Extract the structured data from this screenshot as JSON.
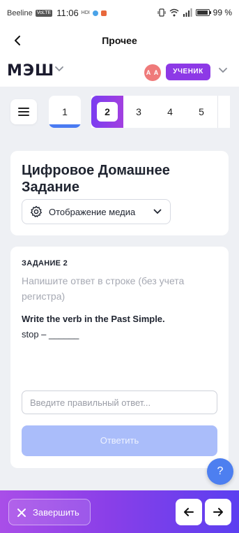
{
  "status_bar": {
    "carrier": "Beeline",
    "network_badge": "VoLTE",
    "time": "11:06",
    "small_label": "HDI",
    "battery_percent": "99 %",
    "battery_level": 0.99
  },
  "titlebar": {
    "back_icon": "chevron-left-icon",
    "title": "Прочее"
  },
  "brand": {
    "logo": "МЭШ",
    "avatar_initials": "А А",
    "role": "УЧЕНИК"
  },
  "task_nav": {
    "menu_icon": "hamburger-icon",
    "tabs": [
      "1",
      "2",
      "3",
      "4",
      "5"
    ],
    "selected_tab": "2",
    "completed_tab": "1"
  },
  "homework": {
    "title": "Цифровое Домашнее Задание",
    "media_button_label": "Отображение медиа"
  },
  "task": {
    "label": "ЗАДАНИЕ 2",
    "instruction": "Напишите ответ в строке (без учета регистра)",
    "question": "Write the verb in the Past Simple.",
    "answer_line": "stop – ______",
    "input_placeholder": "Введите правильный ответ...",
    "input_value": "",
    "submit_label": "Ответить"
  },
  "help": {
    "label": "?"
  },
  "bottom": {
    "finish_label": "Завершить",
    "prev_icon": "arrow-left-icon",
    "next_icon": "arrow-right-icon"
  },
  "colors": {
    "accent_blue": "#4a7bf2",
    "accent_purple": "#8d39e6",
    "submit_disabled": "#aabdfa",
    "avatar": "#ef7a7a"
  }
}
